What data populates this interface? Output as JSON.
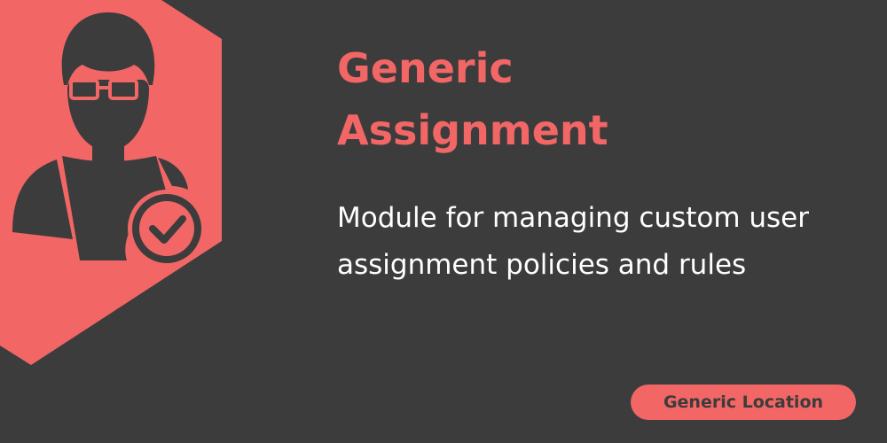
{
  "title": {
    "line1": "Generic",
    "line2": "Assignment"
  },
  "description": "Module for managing custom user assignment policies and rules",
  "badge": {
    "label": "Generic Location"
  },
  "icon": {
    "name": "user-assignment-icon",
    "parts": [
      "user-glasses-icon",
      "check-circle-icon"
    ]
  },
  "colors": {
    "background": "#3c3c3c",
    "accent": "#f26666",
    "text": "#ffffff"
  }
}
